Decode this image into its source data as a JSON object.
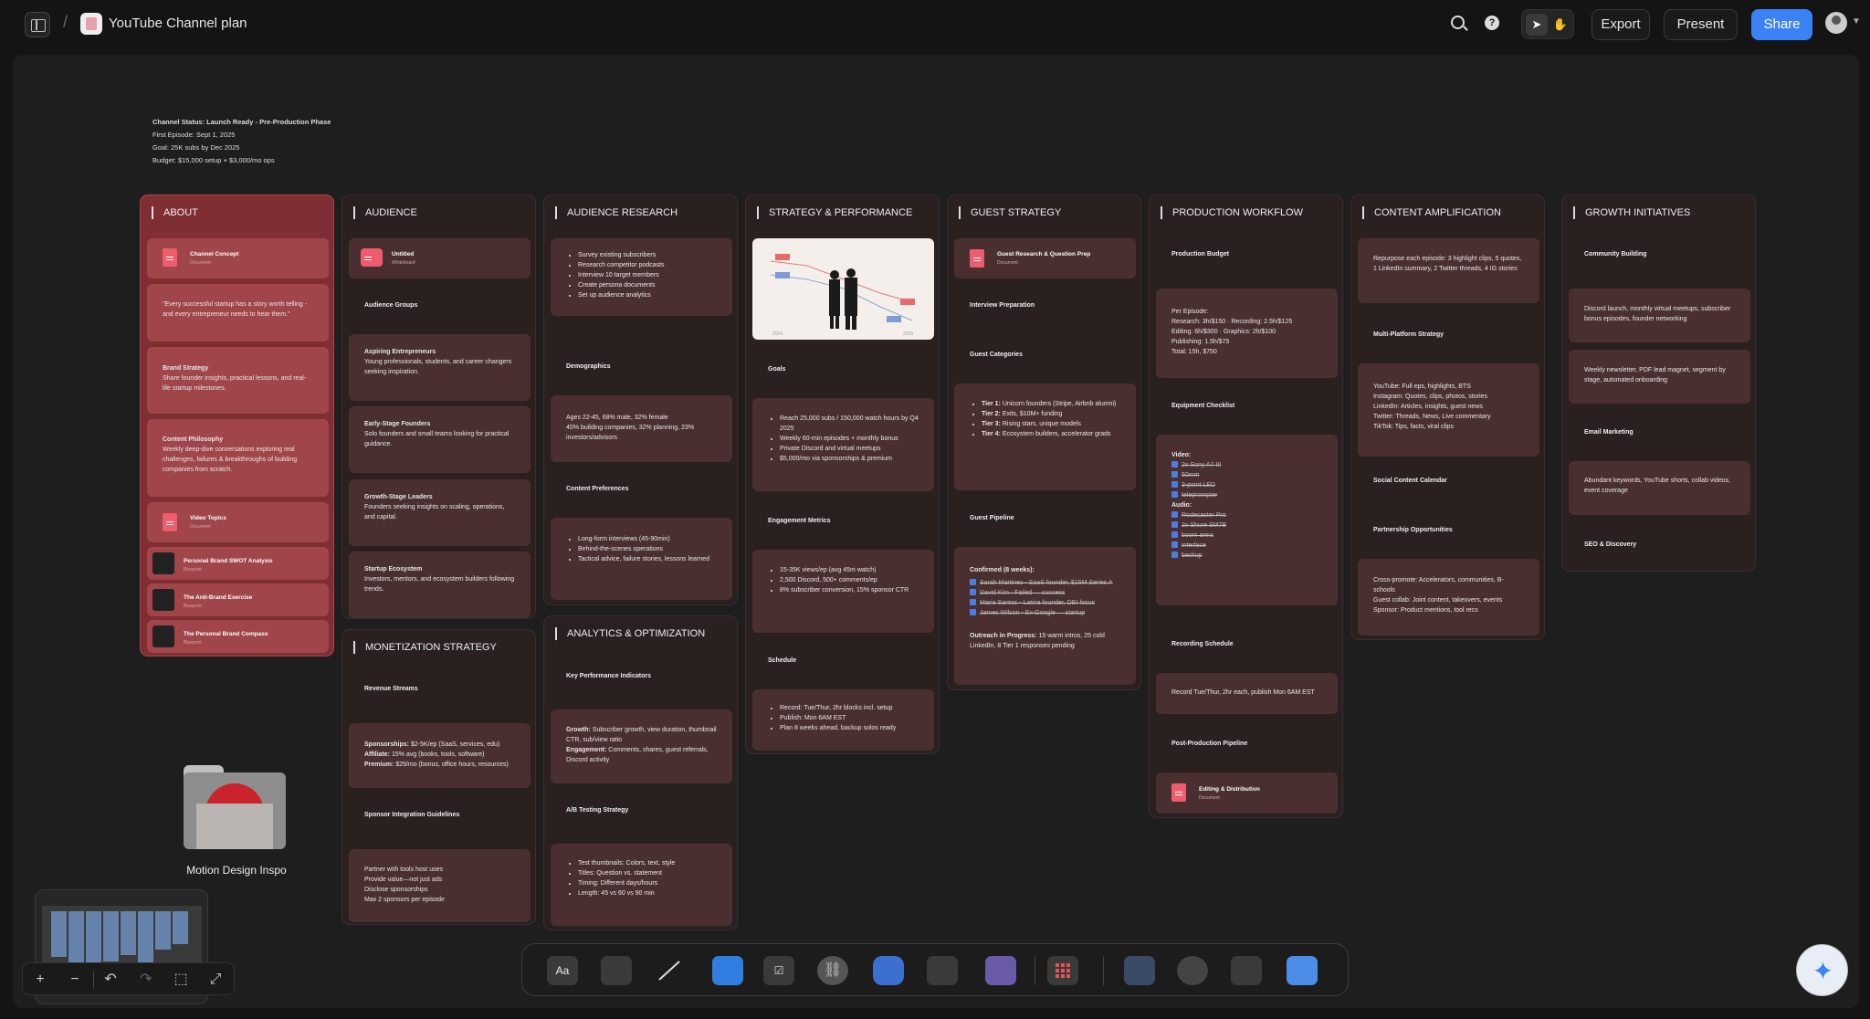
{
  "app": {
    "title": "YouTube Channel plan"
  },
  "toolbar": {
    "export": "Export",
    "present": "Present",
    "share": "Share",
    "help": "?"
  },
  "status": {
    "line1": "Channel Status: Launch Ready - Pre-Production Phase",
    "line2": "First Episode: Sept 1, 2025",
    "line3": "Goal: 25K subs by Dec 2025",
    "line4": "Budget: $15,000 setup + $3,000/mo ops"
  },
  "about": {
    "title": "ABOUT",
    "doc1": {
      "title": "Channel Concept",
      "sub": "Document"
    },
    "quote": "\"Every successful startup has a story worth telling - and every entrepreneur needs to hear them.\"",
    "brand_title": "Brand Strategy",
    "brand_text": "Share founder insights, practical lessons, and real-life startup milestones.",
    "philo_title": "Content Philosophy",
    "philo_text": "Weekly deep-dive conversations exploring real challenges, failures & breakthroughs of building companies from scratch.",
    "doc2": {
      "title": "Video Topics",
      "sub": "Document"
    },
    "board1": {
      "title": "Personal Brand SWOT Analysis",
      "sub": "Blueprint"
    },
    "board2": {
      "title": "The Anti-Brand Exercise",
      "sub": "Blueprint"
    },
    "board3": {
      "title": "The Personal Brand Compass",
      "sub": "Blueprint"
    }
  },
  "audience": {
    "title": "AUDIENCE",
    "wb": {
      "title": "Untitled",
      "sub": "Whiteboard"
    },
    "groups": "Audience Groups",
    "g1_title": "Aspiring Entrepreneurs",
    "g1_text": "Young professionals, students, and career changers seeking inspiration.",
    "g2_title": "Early-Stage Founders",
    "g2_text": "Solo founders and small teams looking for practical guidance.",
    "g3_title": "Growth-Stage Leaders",
    "g3_text": "Founders seeking insights on scaling, operations, and capital.",
    "g4_title": "Startup Ecosystem",
    "g4_text": "Investors, mentors, and ecosystem builders following trends."
  },
  "monetization": {
    "title": "MONETIZATION STRATEGY",
    "revenue": "Revenue Streams",
    "sp_label": "Sponsorships:",
    "sp_text": " $2-5K/ep (SaaS, services, edu)",
    "af_label": "Affiliate:",
    "af_text": " 15% avg (books, tools, software)",
    "pr_label": "Premium:",
    "pr_text": " $29/mo (bonus, office hours, resources)",
    "guidelines": "Sponsor Integration Guidelines",
    "gl": [
      "Partner with tools host uses",
      "Provide value—not just ads",
      "Disclose sponsorships",
      "Max 2 sponsors per episode"
    ]
  },
  "research": {
    "title": "AUDIENCE RESEARCH",
    "steps": [
      "Survey existing subscribers",
      "Research competitor podcasts",
      "Interview 10 target members",
      "Create persona documents",
      "Set up audience analytics"
    ],
    "demo_title": "Demographics",
    "demo_text": "Ages 22-45, 68% male, 32% female\n45% building companies, 32% planning, 23% investors/advisors",
    "pref_title": "Content Preferences",
    "prefs": [
      "Long-form interviews (45-90min)",
      "Behind-the-scenes operations",
      "Tactical advice, failure stories, lessons learned"
    ]
  },
  "analytics": {
    "title": "ANALYTICS & OPTIMIZATION",
    "kpi_title": "Key Performance Indicators",
    "growth_label": "Growth:",
    "growth_text": " Subscriber growth, view duration, thumbnail CTR, sub/view ratio",
    "eng_label": "Engagement:",
    "eng_text": " Comments, shares, guest referrals, Discord activity",
    "ab_title": "A/B Testing Strategy",
    "ab": [
      "Test thumbnails: Colors, text, style",
      "Titles: Question vs. statement",
      "Timing: Different days/hours",
      "Length: 45 vs 60 vs 90 min"
    ]
  },
  "strategy": {
    "title": "STRATEGY & PERFORMANCE",
    "goals_title": "Goals",
    "goals": [
      "Reach 25,000 subs / 150,000 watch hours by Q4 2025",
      "Weekly 60-min episodes + monthly bonus",
      "Private Discord and virtual meetups",
      "$5,000/mo via sponsorships & premium"
    ],
    "eng_title": "Engagement Metrics",
    "eng": [
      "15-35K views/ep (avg 45m watch)",
      "2,500 Discord, 500+ comments/ep",
      "8% subscriber conversion, 15% sponsor CTR"
    ],
    "sched_title": "Schedule",
    "sched": [
      "Record: Tue/Thur, 2hr blocks incl. setup",
      "Publish: Mon 6AM EST",
      "Plan 8 weeks ahead, backup solos ready"
    ]
  },
  "guest": {
    "title": "GUEST STRATEGY",
    "doc": {
      "title": "Guest Research & Question Prep",
      "sub": "Document"
    },
    "prep": "Interview Preparation",
    "cats": "Guest Categories",
    "tiers": [
      {
        "label": "Tier 1:",
        "text": " Unicorn founders (Stripe, Airbnb alumni)"
      },
      {
        "label": "Tier 2:",
        "text": " Exits, $10M+ funding"
      },
      {
        "label": "Tier 3:",
        "text": " Rising stars, unique models"
      },
      {
        "label": "Tier 4:",
        "text": " Ecosystem builders, accelerator grads"
      }
    ],
    "pipeline": "Guest Pipeline",
    "confirmed": "Confirmed (8 weeks):",
    "guests": [
      "Sarah Martinez - SaaS founder, $15M Series A",
      "David Kim - Failed → success",
      "Maria Santos - Latina founder, DEI focus",
      "James Wilson - Ex-Google → startup"
    ],
    "outreach_label": "Outreach in Progress:",
    "outreach_text": " 15 warm intros, 25 cold LinkedIn, 8 Tier 1 responses pending"
  },
  "production": {
    "title": "PRODUCTION WORKFLOW",
    "budget": "Production Budget",
    "per_ep": "Per Episode:",
    "b_lines": [
      "Research: 3h/$150 · Recording: 2.5h/$125",
      "Editing: 6h/$300 · Graphics: 2h/$100",
      "Publishing: 1.5h/$75",
      "Total: 15h, $750"
    ],
    "equip": "Equipment Checklist",
    "video": "Video:",
    "video_items": [
      "2x Sony A7 III",
      "50mm",
      "3-point LED",
      "teleprompter"
    ],
    "audio": "Audio:",
    "audio_items": [
      "Rodecaster Pro",
      "2x Shure SM7B",
      "boom arms",
      "interface",
      "backup"
    ],
    "rec_title": "Recording Schedule",
    "rec_text": "Record Tue/Thur, 2hr each, publish Mon 6AM EST",
    "post_title": "Post-Production Pipeline",
    "doc": {
      "title": "Editing & Distribution",
      "sub": "Document"
    }
  },
  "amplification": {
    "title": "CONTENT AMPLIFICATION",
    "repurpose": "Repurpose each episode: 3 highlight clips, 5 quotes, 1 LinkedIn summary, 2 Twitter threads, 4 IG stories",
    "multi": "Multi-Platform Strategy",
    "platforms": [
      "YouTube: Full eps, highlights, BTS",
      "Instagram: Quotes, clips, photos, stories",
      "LinkedIn: Articles, insights, guest news",
      "Twitter: Threads, News, Live commentary",
      "TikTok: Tips, facts, viral clips"
    ],
    "calendar": "Social Content Calendar",
    "partners": "Partnership Opportunities",
    "p_lines": [
      "Cross-promote: Accelerators, communities, B-schools",
      "Guest collab: Joint content, takeovers, events",
      "Sponsor: Product mentions, tool recs"
    ]
  },
  "growth": {
    "title": "GROWTH INITIATIVES",
    "community": "Community Building",
    "c_text": "Discord launch, monthly virtual meetups, subscriber bonus episodes, founder networking",
    "c2_text": "Weekly newsletter, PDF lead magnet, segment by stage, automated onboarding",
    "email": "Email Marketing",
    "e_text": "Abundant keywords, YouTube shorts, collab videos, event coverage",
    "seo": "SEO & Discovery"
  },
  "folder": {
    "label": "Motion Design Inspo"
  },
  "chart_thumb": {
    "years": [
      "2024",
      "2025"
    ]
  },
  "icons": [
    "sidebar-toggle-icon",
    "search-icon",
    "help-icon",
    "pointer-icon",
    "hand-icon",
    "plus-icon",
    "minus-icon",
    "undo-icon",
    "redo-icon",
    "fit-icon",
    "fullscreen-icon",
    "sparkle-icon"
  ],
  "dock": {
    "text_tool": "Aa"
  },
  "colors": {
    "accent": "#3b82f6",
    "about_bg": "#7f2f33",
    "column_bg": "#2a2020",
    "card_bg": "#4a2f30",
    "doc_red": "#ee5c6d"
  }
}
